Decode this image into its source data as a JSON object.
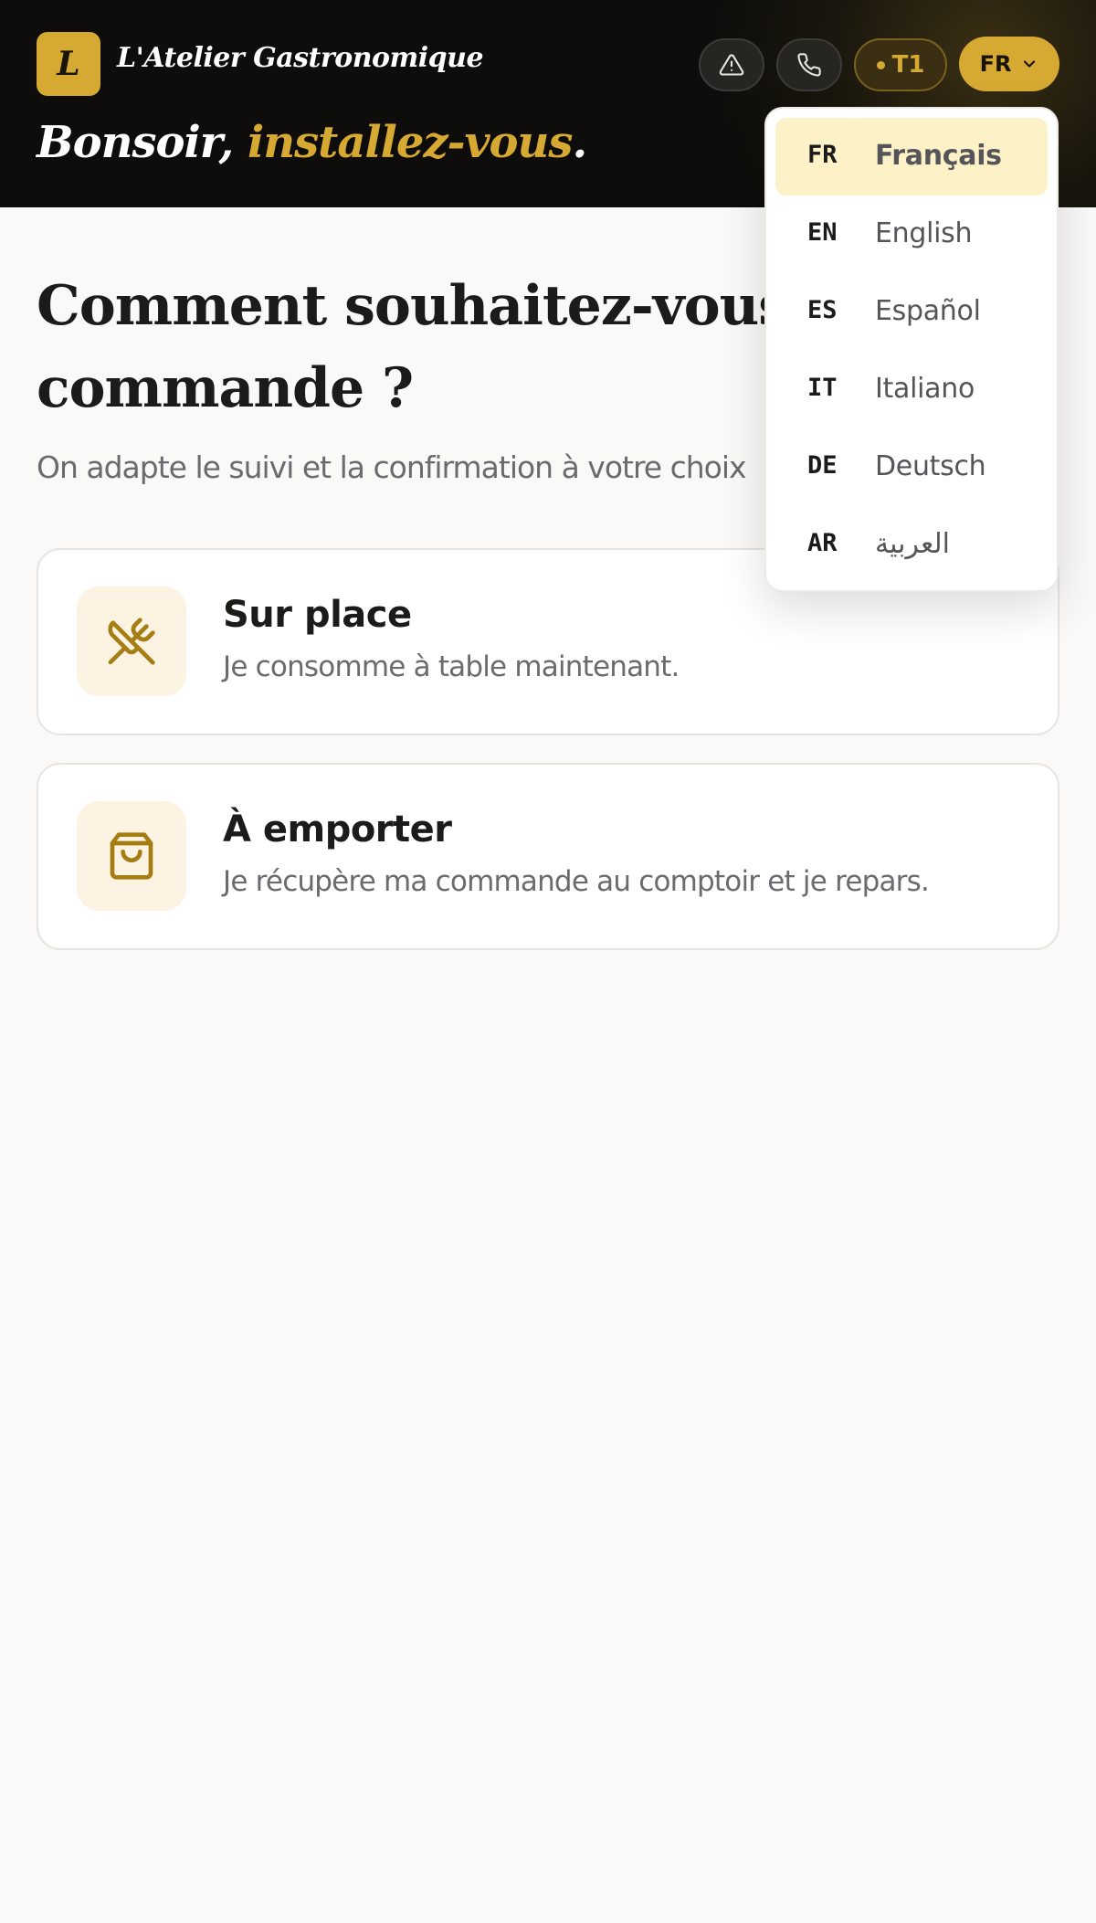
{
  "header": {
    "logo_letter": "L",
    "brand": "L'Atelier Gastronomique",
    "greeting_main": "Bonsoir, ",
    "greeting_accent": "installez-vous",
    "greeting_end": ".",
    "table_label": "T1",
    "language_code": "FR",
    "icons": [
      "warning-icon",
      "phone-icon",
      "chevron-down-icon"
    ]
  },
  "main": {
    "title": "Comment souhaitez-vous vo commande ?",
    "subtitle": "On adapte le suivi et la confirmation à votre choix"
  },
  "options": [
    {
      "title": "Sur place",
      "description": "Je consomme à table maintenant.",
      "icon": "utensils-crossed-icon"
    },
    {
      "title": "À emporter",
      "description": "Je récupère ma commande au comptoir et je repars.",
      "icon": "shopping-bag-icon"
    }
  ],
  "languages": [
    {
      "code": "FR",
      "label": "Français",
      "selected": true
    },
    {
      "code": "EN",
      "label": "English"
    },
    {
      "code": "ES",
      "label": "Español"
    },
    {
      "code": "IT",
      "label": "Italiano"
    },
    {
      "code": "DE",
      "label": "Deutsch"
    },
    {
      "code": "AR",
      "label": "العربية"
    }
  ],
  "colors": {
    "accent": "#d6aa32",
    "header_bg": "#0e0d0b",
    "page_bg": "#faf9f7",
    "icon_tile_bg": "#fdf3e3",
    "icon_color": "#a57d12"
  }
}
